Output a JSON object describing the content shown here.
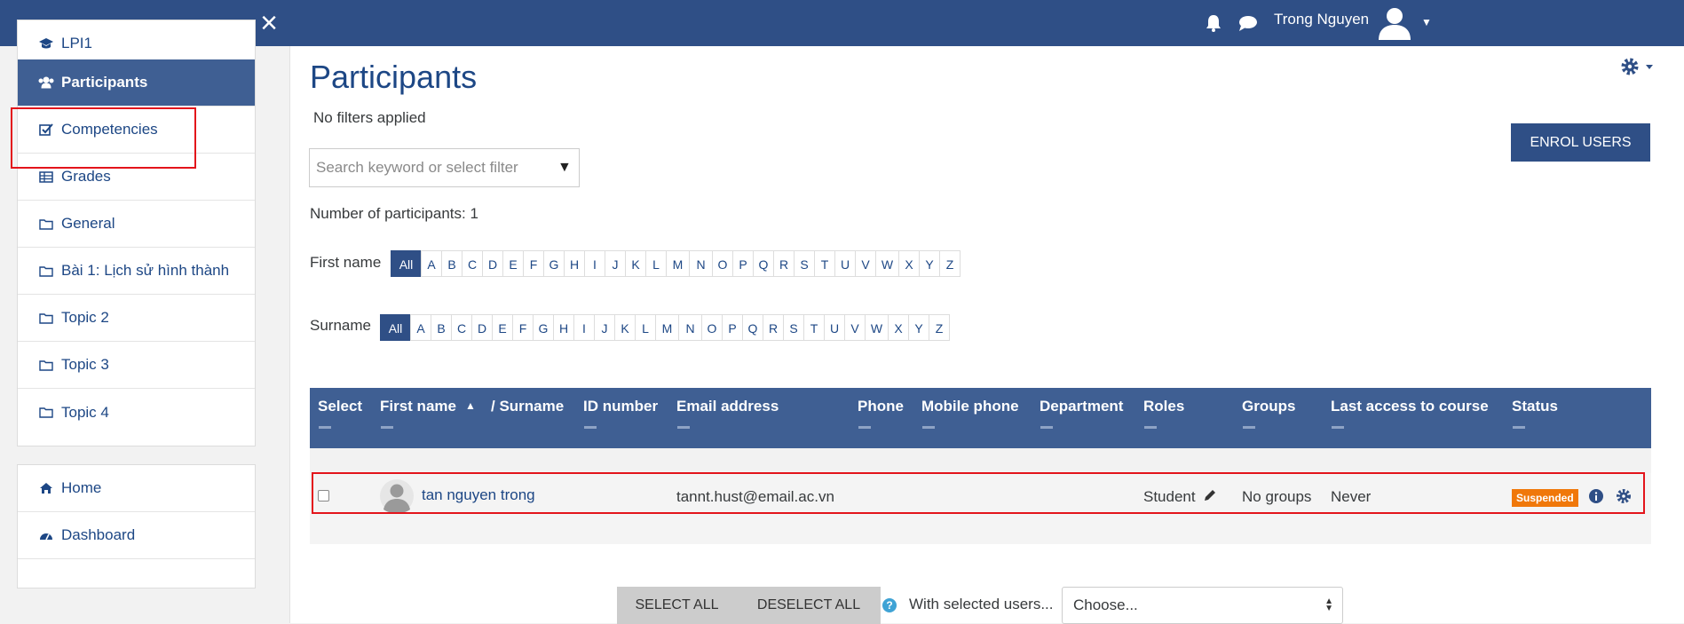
{
  "navbar": {
    "user_name": "Trong Nguyen"
  },
  "sidebar": {
    "course_items": [
      {
        "label": "LPI1",
        "icon": "graduation-cap-icon"
      },
      {
        "label": "Participants",
        "icon": "users-icon",
        "active": true
      },
      {
        "label": "Competencies",
        "icon": "check-square-icon"
      },
      {
        "label": "Grades",
        "icon": "table-icon"
      },
      {
        "label": "General",
        "icon": "folder-icon"
      },
      {
        "label": "Bài 1: Lịch sử hình thành",
        "icon": "folder-icon"
      },
      {
        "label": "Topic 2",
        "icon": "folder-icon"
      },
      {
        "label": "Topic 3",
        "icon": "folder-icon"
      },
      {
        "label": "Topic 4",
        "icon": "folder-icon"
      }
    ],
    "site_items": [
      {
        "label": "Home",
        "icon": "home-icon"
      },
      {
        "label": "Dashboard",
        "icon": "dashboard-icon"
      }
    ]
  },
  "main": {
    "title": "Participants",
    "filter_status": "No filters applied",
    "search_placeholder": "Search keyword or select filter",
    "participant_count": "Number of participants: 1",
    "enrol_button": "ENROL USERS",
    "firstname_label": "First name",
    "surname_label": "Surname",
    "all_label": "All",
    "letters": [
      "A",
      "B",
      "C",
      "D",
      "E",
      "F",
      "G",
      "H",
      "I",
      "J",
      "K",
      "L",
      "M",
      "N",
      "O",
      "P",
      "Q",
      "R",
      "S",
      "T",
      "U",
      "V",
      "W",
      "X",
      "Y",
      "Z"
    ]
  },
  "table": {
    "headers": {
      "select": "Select",
      "first_name": "First name",
      "surname": "/ Surname",
      "id_number": "ID number",
      "email": "Email address",
      "phone": "Phone",
      "mobile": "Mobile phone",
      "department": "Department",
      "roles": "Roles",
      "groups": "Groups",
      "last_access": "Last access to course",
      "status": "Status"
    },
    "rows": [
      {
        "name": "tan nguyen trong",
        "email": "tannt.hust@email.ac.vn",
        "role": "Student",
        "groups": "No groups",
        "last_access": "Never",
        "status": "Suspended"
      }
    ]
  },
  "bulk": {
    "select_all": "SELECT ALL",
    "deselect_all": "DESELECT ALL",
    "with_selected": "With selected users...",
    "choose": "Choose..."
  },
  "colors": {
    "navbar": "#2f4f86",
    "link": "#1d4785",
    "suspended": "#f0780a",
    "highlight": "#e3141b"
  }
}
